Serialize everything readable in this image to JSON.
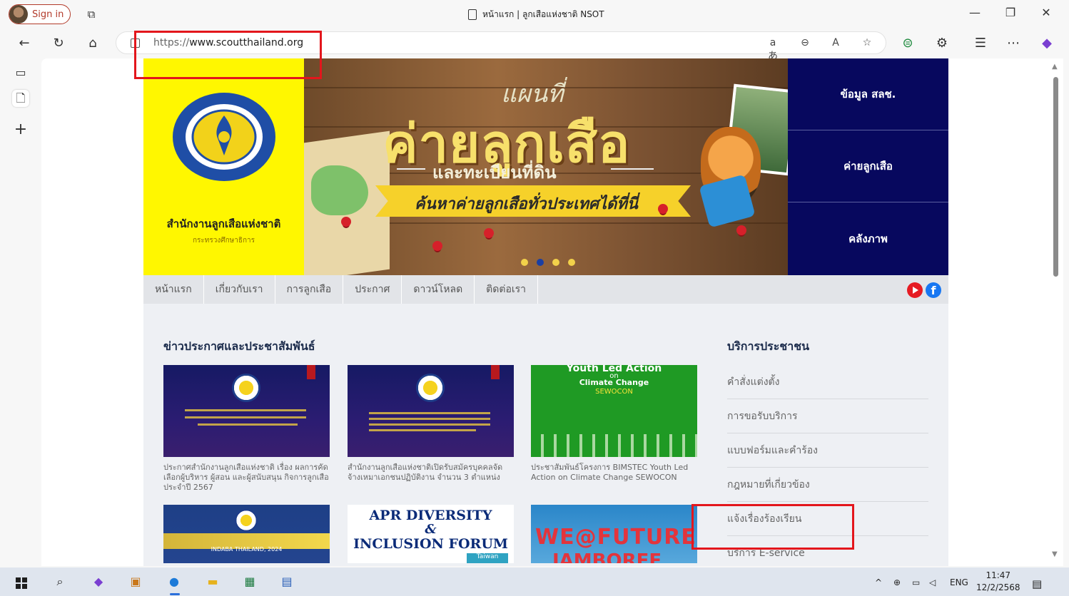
{
  "browser": {
    "signin_label": "Sign in",
    "tab_title": "หน้าแรก | ลูกเสือแห่งชาติ NSOT",
    "url_proto": "https://",
    "url_host": "www.scoutthailand.org",
    "omnibox_icons": [
      "read-aloud-aa-icon",
      "zoom-icon",
      "read-aloud-icon",
      "favorite-star-icon"
    ],
    "window_controls": [
      "minimize",
      "restore",
      "close"
    ]
  },
  "site": {
    "org_name": "สำนักงานลูกเสือแห่งชาติ",
    "org_sub": "กระทรวงศึกษาธิการ",
    "banner": {
      "headline_small": "แผนที่",
      "headline_big": "ค่ายลูกเสือ",
      "headline_sub": "และทะเบียนที่ดิน",
      "ribbon": "ค้นหาค่ายลูกเสือทั่วประเทศได้ที่นี่",
      "slide_count": 4,
      "active_slide": 2
    },
    "right_menu": [
      "ข้อมูล สลช.",
      "ค่ายลูกเสือ",
      "คลังภาพ"
    ],
    "main_nav": [
      "หน้าแรก",
      "เกี่ยวกับเรา",
      "การลูกเสือ",
      "ประกาศ",
      "ดาวน์โหลด",
      "ติดต่อเรา"
    ],
    "news": {
      "title": "ข่าวประกาศและประชาสัมพันธ์",
      "items": [
        {
          "caption": "ประกาศสำนักงานลูกเสือแห่งชาติ เรื่อง ผลการคัดเลือกผู้บริหาร ผู้สอน และผู้สนับสนุน กิจการลูกเสือ ประจำปี 2567"
        },
        {
          "caption": "สำนักงานลูกเสือแห่งชาติเปิดรับสมัครบุคคลจัดจ้างเหมาเอกชนปฏิบัติงาน จำนวน 3 ตำแหน่ง"
        },
        {
          "caption": "ประชาสัมพันธ์โครงการ BIMSTEC Youth Led Action on Climate Change SEWOCON",
          "thumb_title": "Youth Led Action",
          "thumb_on": "on",
          "thumb_sub": "Climate Change",
          "thumb_sub2": "SEWOCON"
        },
        {
          "caption": "",
          "thumb_title": "INDABA THAILAND, 2024"
        },
        {
          "caption": "",
          "thumb_line1": "APR DIVERSITY",
          "thumb_line2": "&",
          "thumb_line3": "INCLUSION FORUM",
          "thumb_tag": "Taiwan"
        },
        {
          "caption": "",
          "thumb_line1": "WE@FUTURE",
          "thumb_line2": "JAMBOREE"
        }
      ]
    },
    "services": {
      "title": "บริการประชาชน",
      "items": [
        "คำสั่งแต่งตั้ง",
        "การขอรับบริการ",
        "แบบฟอร์มและคำร้อง",
        "กฎหมายที่เกี่ยวข้อง",
        "แจ้งเรื่องร้องเรียน",
        "บริการ E-service"
      ]
    }
  },
  "taskbar": {
    "lang": "ENG",
    "time": "11:47",
    "date": "12/2/2568"
  },
  "colors": {
    "logo_bg": "#fff700",
    "menu_bg": "#07085e",
    "annotation_red": "#e3161c"
  }
}
